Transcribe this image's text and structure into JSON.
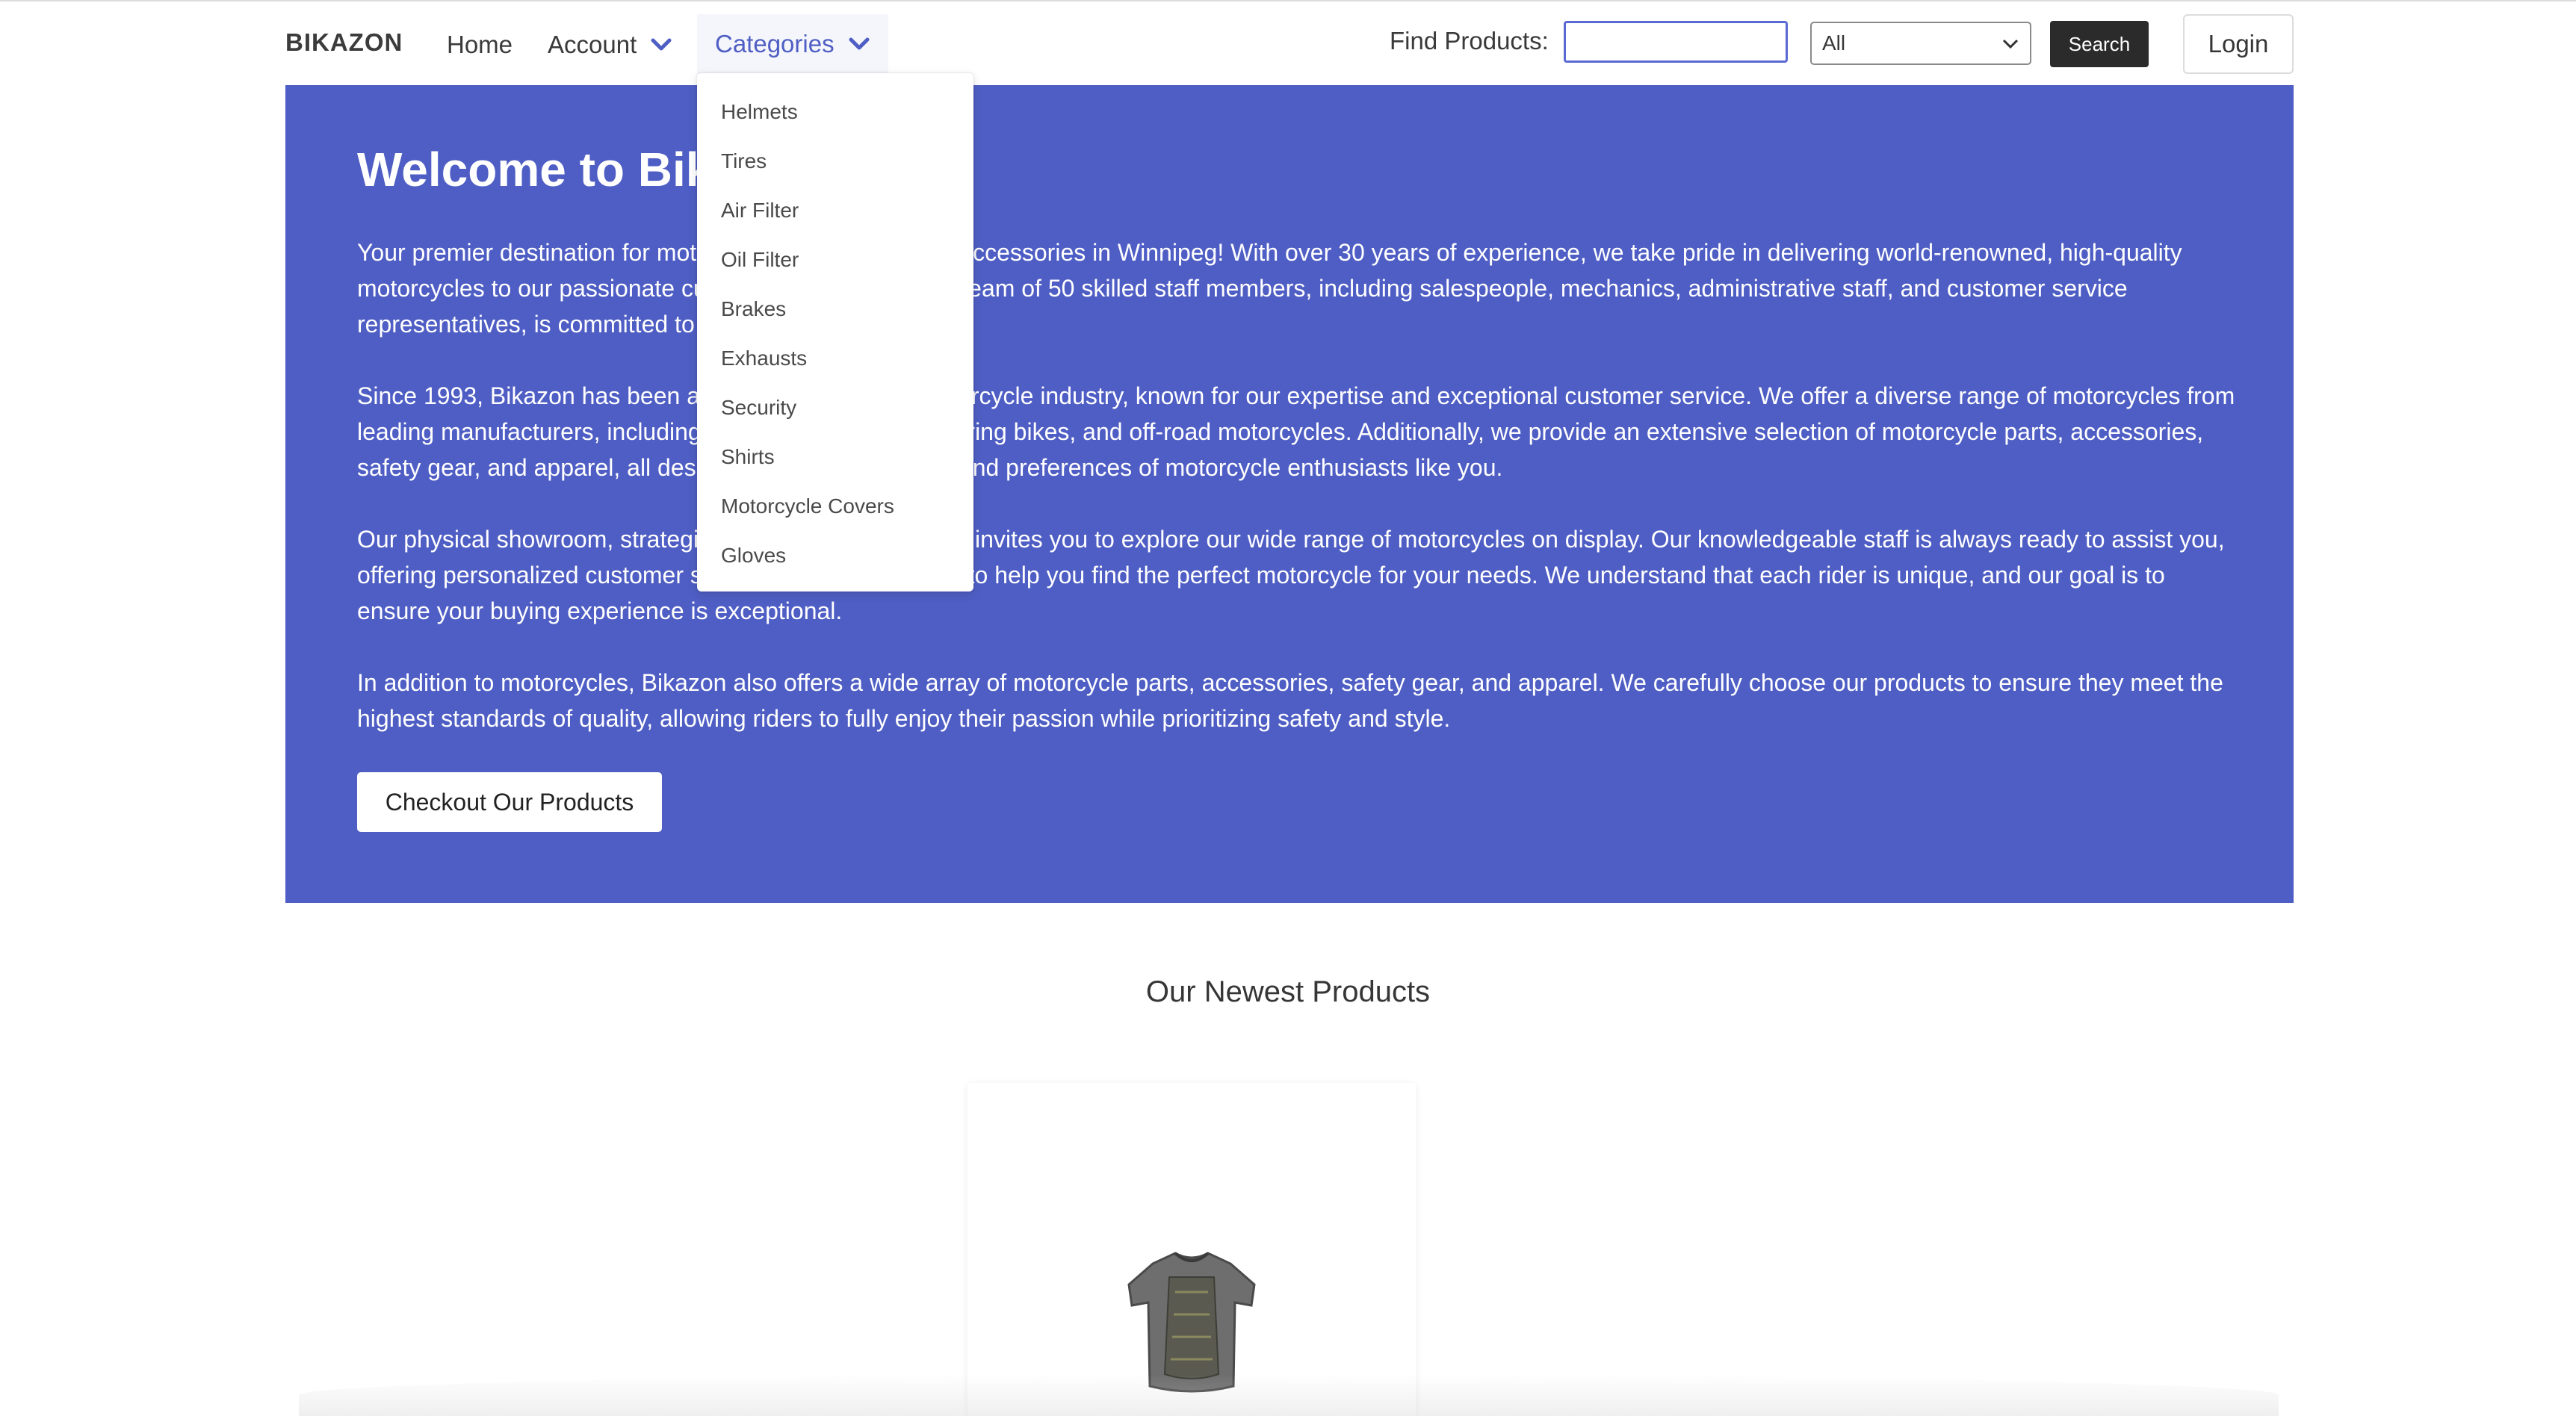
{
  "navbar": {
    "brand": "BIKAZON",
    "home": "Home",
    "account": "Account",
    "categories": "Categories",
    "find_label": "Find Products:",
    "search_value": "",
    "select_value": "All",
    "search_button": "Search",
    "login_button": "Login"
  },
  "dropdown": {
    "items": [
      "Helmets",
      "Tires",
      "Air Filter",
      "Oil Filter",
      "Brakes",
      "Exhausts",
      "Security",
      "Shirts",
      "Motorcycle Covers",
      "Gloves"
    ]
  },
  "hero": {
    "title": "Welcome to Bikazon",
    "p1": "Your premier destination for motorcycles and motorcycle accessories in Winnipeg! With over 30 years of experience, we take pride in delivering world-renowned, high-quality motorcycles to our passionate customers. Our dedicated team of 50 skilled staff members, including salespeople, mechanics, administrative staff, and customer service representatives, is committed to your satisfaction.",
    "p2": "Since 1993, Bikazon has been a trusted name in the motorcycle industry, known for our expertise and exceptional customer service. We offer a diverse range of motorcycles from leading manufacturers, including sport bikes, cruisers, touring bikes, and off-road motorcycles. Additionally, we provide an extensive selection of motorcycle parts, accessories, safety gear, and apparel, all designed to meet the needs and preferences of motorcycle enthusiasts like you.",
    "p3": "Our physical showroom, strategically located in Winnipeg, invites you to explore our wide range of motorcycles on display. Our knowledgeable staff is always ready to assist you, offering personalized customer service and expert advice to help you find the perfect motorcycle for your needs. We understand that each rider is unique, and our goal is to ensure your buying experience is exceptional.",
    "p4": "In addition to motorcycles, Bikazon also offers a wide array of motorcycle parts, accessories, safety gear, and apparel. We carefully choose our products to ensure they meet the highest standards of quality, allowing riders to fully enjoy their passion while prioritizing safety and style.",
    "button": "Checkout Our Products"
  },
  "newest": {
    "title": "Our Newest Products"
  },
  "colors": {
    "accent": "#4f5ec4",
    "dark_button": "#2b2b2b"
  },
  "icons": [
    "chevron-down-icon",
    "shirt-product-image"
  ]
}
